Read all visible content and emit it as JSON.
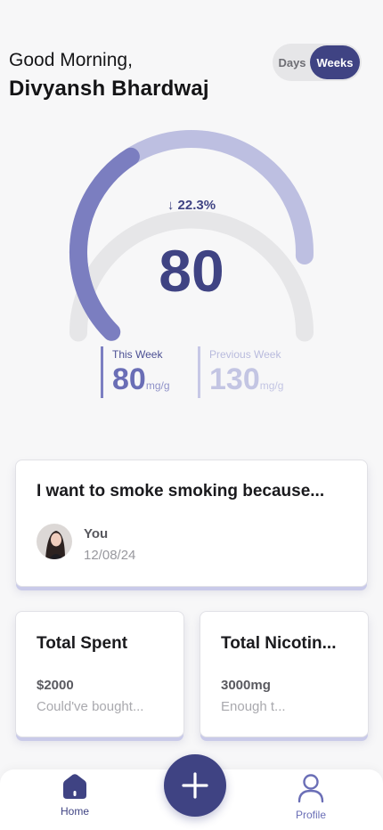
{
  "header": {
    "greeting": "Good Morning,",
    "name": "Divyansh Bhardwaj",
    "toggle_days": "Days",
    "toggle_weeks": "Weeks",
    "toggle_selected": "Weeks"
  },
  "gauge": {
    "delta": "↓ 22.3%",
    "value": "80",
    "this_week_fraction": 0.38,
    "previous_week_fraction": 0.84,
    "colors": {
      "this_week": "#7b7ec0",
      "previous_week": "#bdbfe1",
      "track": "#e6e6e8"
    }
  },
  "stats": {
    "this_week_label": "This Week",
    "this_week_value": "80",
    "previous_week_label": "Previous Week",
    "previous_week_value": "130",
    "unit": "mg/g"
  },
  "reason_card": {
    "title": "I want to smoke smoking because...",
    "author": "You",
    "date": "12/08/24"
  },
  "spent_card": {
    "title": "Total Spent",
    "amount": "$2000",
    "subtitle": "Could've bought..."
  },
  "nicotine_card": {
    "title": "Total Nicotin...",
    "amount": "3000mg",
    "subtitle": "Enough t..."
  },
  "nav": {
    "home": "Home",
    "profile": "Profile",
    "add_icon": "plus-icon"
  },
  "colors": {
    "accent": "#3f4383"
  }
}
